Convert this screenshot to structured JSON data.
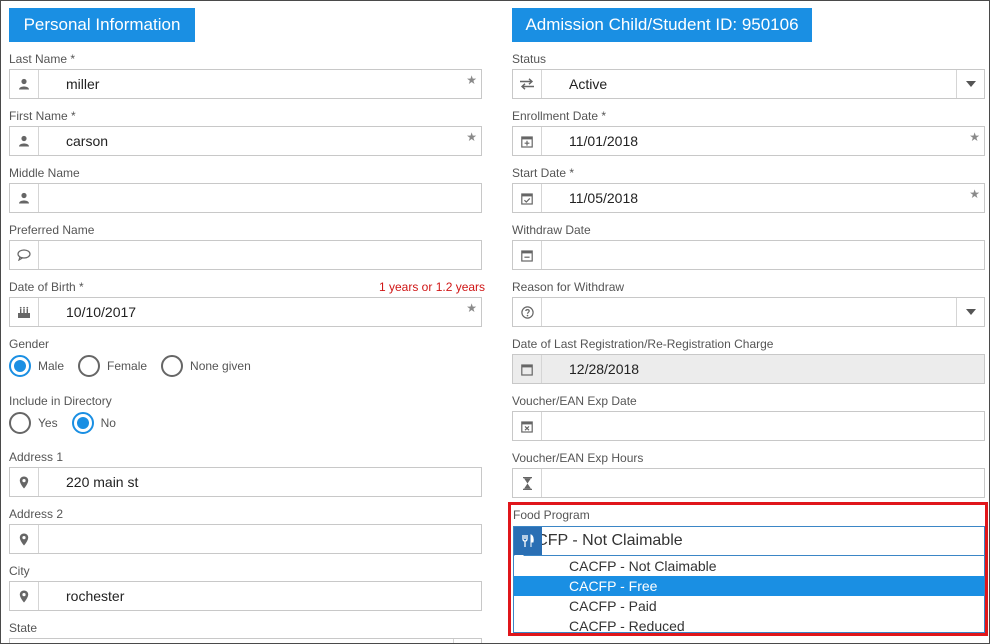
{
  "left": {
    "title": "Personal Information",
    "last_name": {
      "label": "Last Name *",
      "value": "miller"
    },
    "first_name": {
      "label": "First Name *",
      "value": "carson"
    },
    "middle_name": {
      "label": "Middle Name",
      "value": ""
    },
    "preferred_name": {
      "label": "Preferred Name",
      "value": ""
    },
    "dob": {
      "label": "Date of Birth *",
      "hint": "1 years or 1.2 years",
      "value": "10/10/2017"
    },
    "gender": {
      "label": "Gender",
      "options": [
        "Male",
        "Female",
        "None given"
      ],
      "selected": "Male"
    },
    "directory": {
      "label": "Include in Directory",
      "options": [
        "Yes",
        "No"
      ],
      "selected": "No"
    },
    "address1": {
      "label": "Address 1",
      "value": "220 main st"
    },
    "address2": {
      "label": "Address 2",
      "value": ""
    },
    "city": {
      "label": "City",
      "value": "rochester"
    },
    "state": {
      "label": "State"
    }
  },
  "right": {
    "title": "Admission Child/Student ID: 950106",
    "status": {
      "label": "Status",
      "value": "Active"
    },
    "enrollment_date": {
      "label": "Enrollment Date  *",
      "value": "11/01/2018"
    },
    "start_date": {
      "label": "Start Date *",
      "value": "11/05/2018"
    },
    "withdraw_date": {
      "label": "Withdraw Date",
      "value": ""
    },
    "withdraw_reason": {
      "label": "Reason for Withdraw",
      "value": ""
    },
    "last_registration": {
      "label": "Date of Last Registration/Re-Registration Charge",
      "value": "12/28/2018"
    },
    "voucher_date": {
      "label": "Voucher/EAN Exp Date",
      "value": ""
    },
    "voucher_hours": {
      "label": "Voucher/EAN Exp Hours",
      "value": ""
    },
    "food_program": {
      "label": "Food Program",
      "value": "CACFP - Not Claimable",
      "options": [
        "CACFP - Not Claimable",
        "CACFP - Free",
        "CACFP - Paid",
        "CACFP - Reduced"
      ],
      "highlighted": "CACFP - Free"
    }
  },
  "colors": {
    "accent": "#1a8fe3",
    "highlight_border": "#e0161b",
    "hint_text": "#d01515"
  },
  "icons": [
    "user-icon",
    "speech-bubble-icon",
    "cake-icon",
    "map-marker-icon",
    "exchange-icon",
    "calendar-plus-icon",
    "calendar-check-icon",
    "calendar-icon",
    "question-circle-icon",
    "calendar-x-icon",
    "hourglass-icon",
    "cutlery-icon",
    "star-icon",
    "chevron-down-icon"
  ]
}
